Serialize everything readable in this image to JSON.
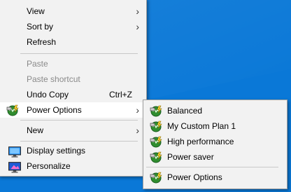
{
  "context_menu": {
    "view": "View",
    "sort_by": "Sort by",
    "refresh": "Refresh",
    "paste": "Paste",
    "paste_shortcut": "Paste shortcut",
    "undo_copy": "Undo Copy",
    "undo_copy_shortcut": "Ctrl+Z",
    "power_options": "Power Options",
    "new": "New",
    "display_settings": "Display settings",
    "personalize": "Personalize"
  },
  "power_submenu": {
    "items": [
      "Balanced",
      "My Custom Plan 1",
      "High performance",
      "Power saver"
    ],
    "power_options": "Power Options"
  },
  "colors": {
    "desktop": "#0a78d7",
    "menu_bg": "#f2f2f2",
    "hover_bg": "#ffffff",
    "disabled_text": "#8a8a8a"
  }
}
